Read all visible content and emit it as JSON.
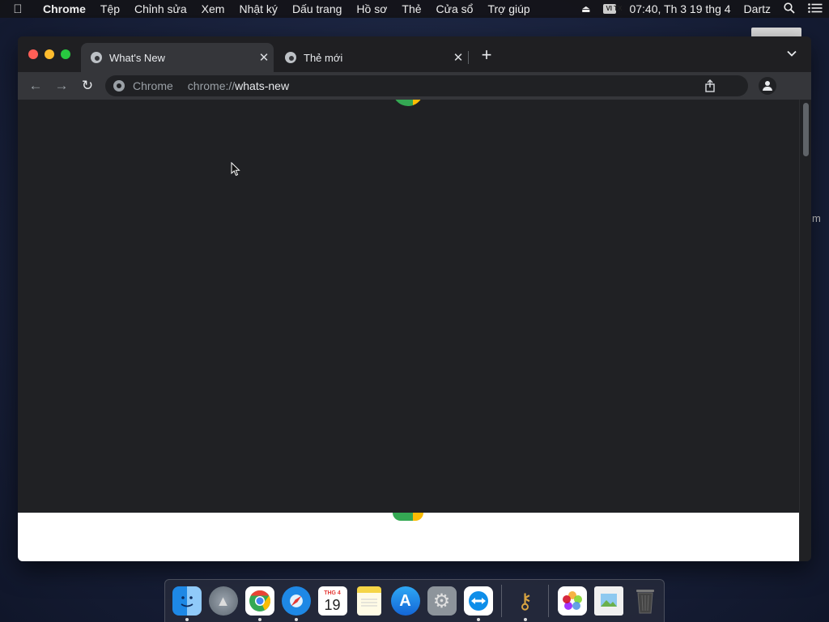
{
  "menubar": {
    "app": "Chrome",
    "items": [
      "Tệp",
      "Chỉnh sửa",
      "Xem",
      "Nhật ký",
      "Dấu trang",
      "Hồ sơ",
      "Thẻ",
      "Cửa sổ",
      "Trợ giúp"
    ],
    "input_source": "VI TX",
    "clock": "07:40, Th 3 19 thg 4",
    "user": "Dartz"
  },
  "desktop": {
    "edge_text": "m"
  },
  "browser": {
    "tabs": [
      {
        "title": "What's New",
        "active": true
      },
      {
        "title": "Thẻ mới",
        "active": false
      }
    ],
    "omnibox": {
      "site_label": "Chrome",
      "scheme": "chrome://",
      "host": "whats-new"
    }
  },
  "calendar_icon": {
    "month": "THG 4",
    "day": "19"
  },
  "dock": {
    "apps": [
      "finder",
      "launchpad",
      "chrome",
      "safari",
      "calendar",
      "notes",
      "app-store",
      "system-preferences",
      "teamviewer",
      "keychain-access",
      "photos",
      "preview",
      "trash"
    ]
  },
  "colors": {
    "page_bg": "#202124",
    "tab_active": "#35363a",
    "chrome_red": "#ea4335",
    "chrome_yellow": "#fbbc04",
    "chrome_green": "#34a853",
    "traffic_red": "#ff5f57",
    "traffic_yellow": "#febc2e",
    "traffic_green": "#28c840"
  }
}
